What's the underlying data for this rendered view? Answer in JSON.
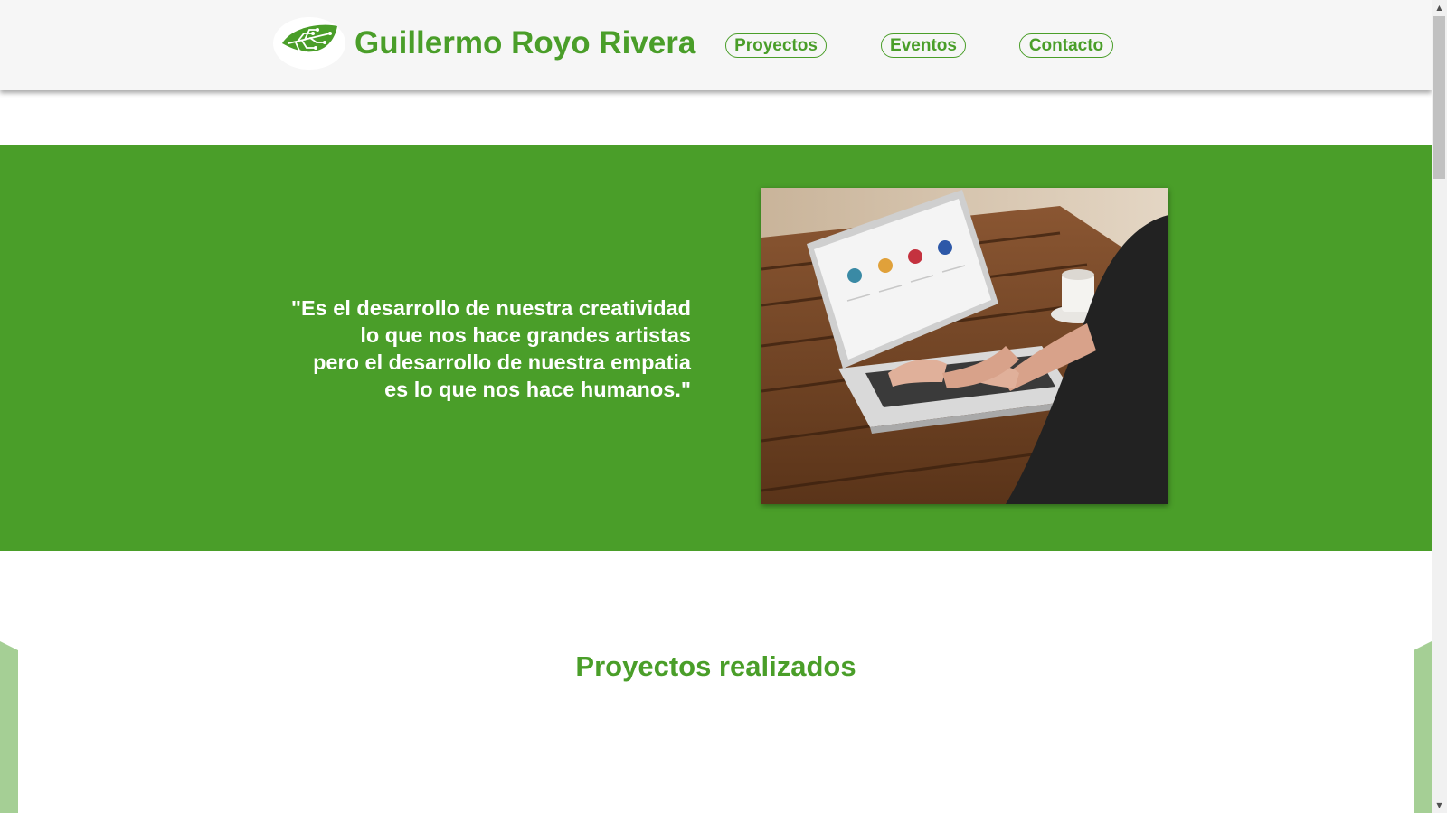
{
  "header": {
    "title": "Guillermo Royo Rivera",
    "logo_icon": "circuit-leaf-icon",
    "nav": [
      {
        "label": "Proyectos"
      },
      {
        "label": "Eventos"
      },
      {
        "label": "Contacto"
      }
    ]
  },
  "hero": {
    "quote_lines": [
      "\"Es el desarrollo de nuestra creatividad",
      "lo que nos hace grandes artistas",
      "pero el desarrollo de nuestra empatia",
      "es lo que nos hace humanos.\""
    ],
    "image": "person-using-laptop-photo"
  },
  "projects": {
    "title": "Proyectos realizados"
  },
  "colors": {
    "brand_green": "#4a9e29",
    "light_green": "#a5cf95",
    "header_bg": "#f6f6f6"
  }
}
